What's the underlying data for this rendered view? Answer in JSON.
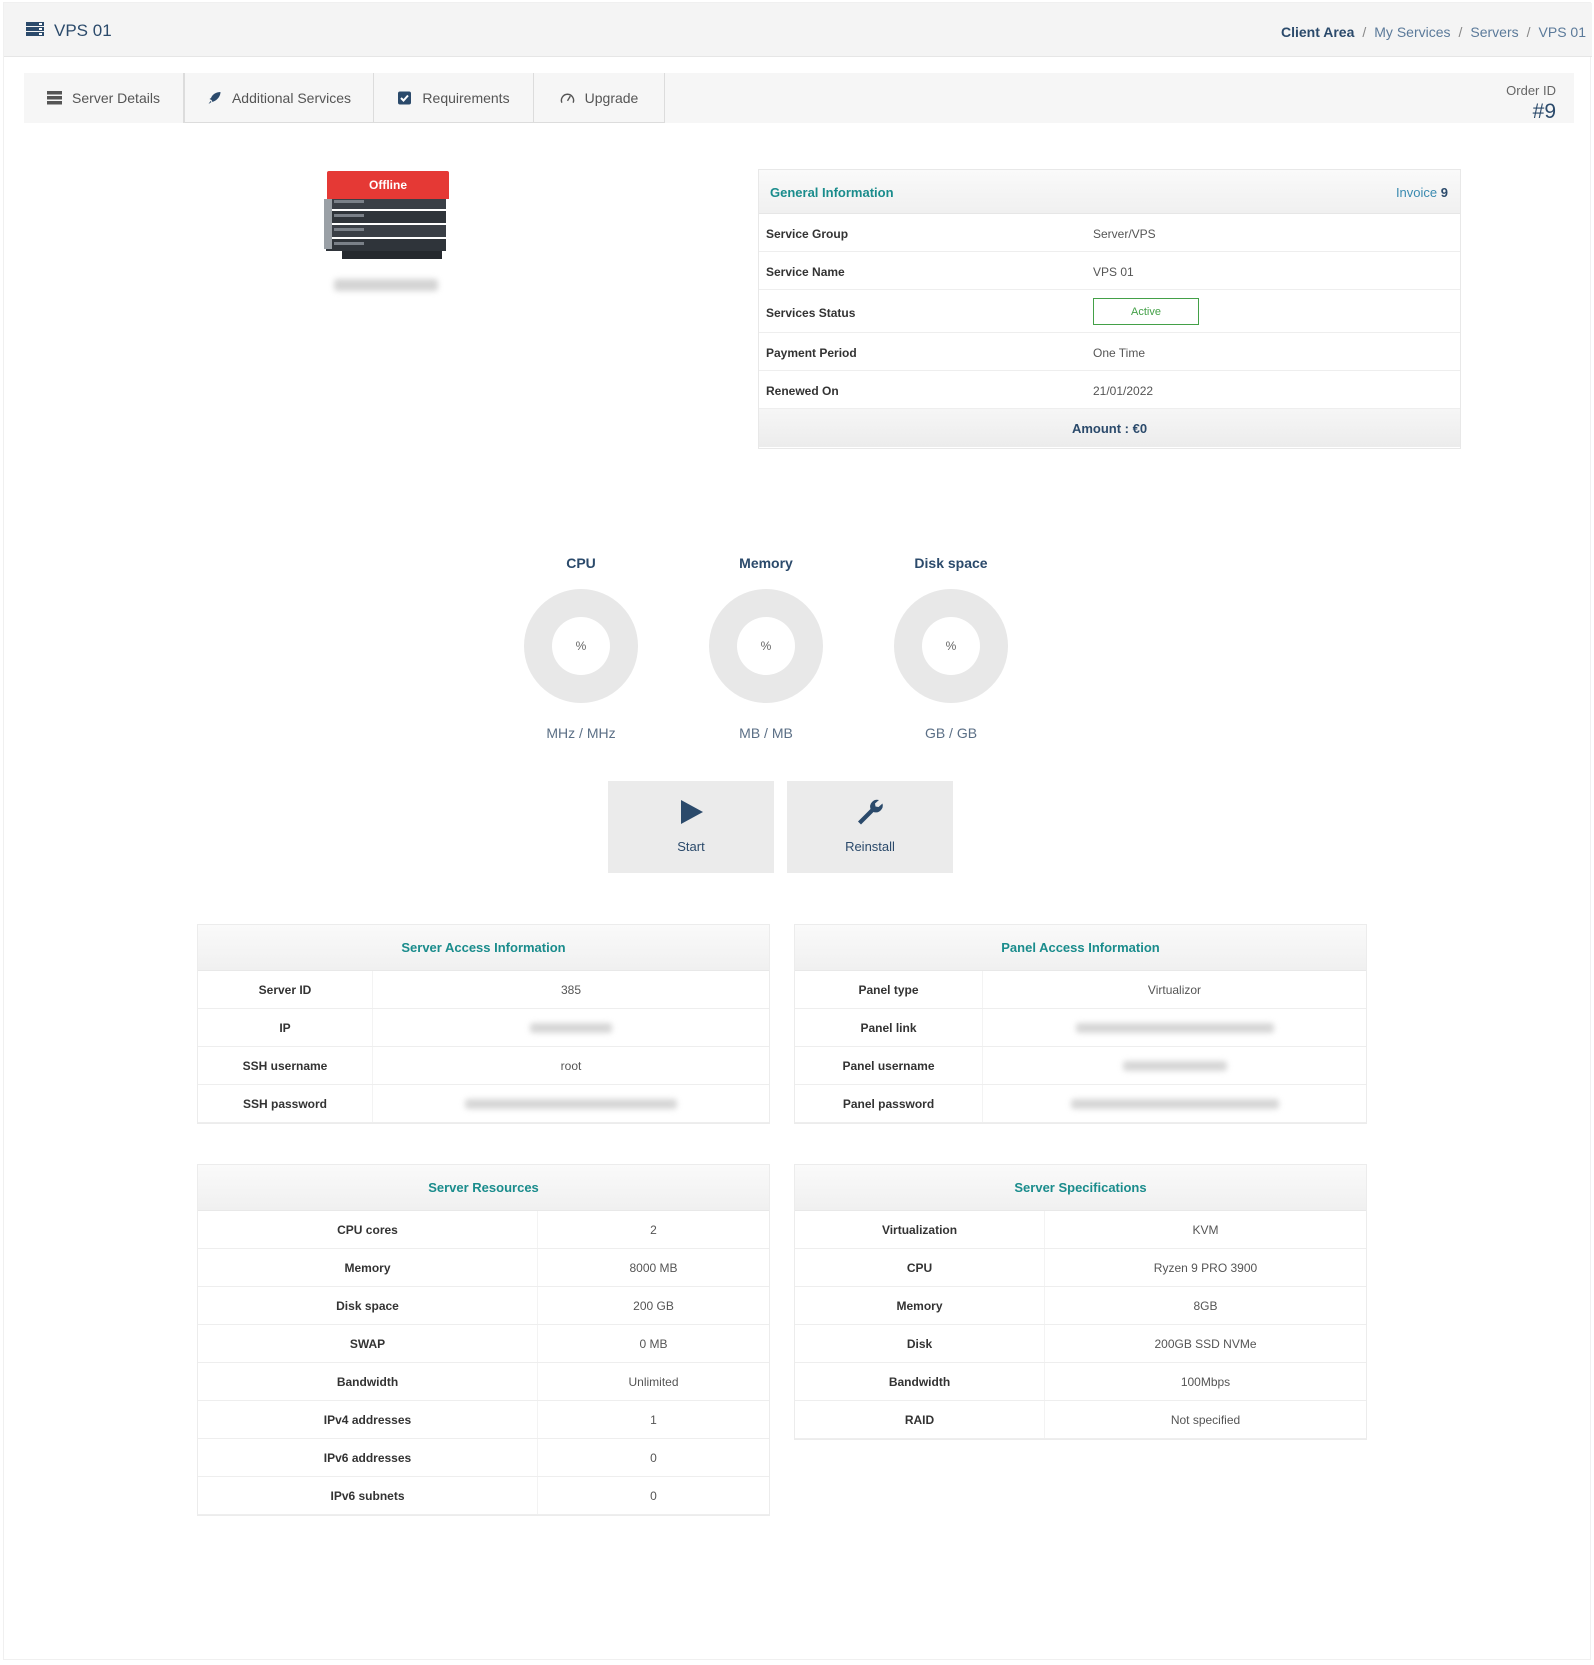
{
  "header": {
    "title": "VPS 01",
    "breadcrumb": {
      "client_area": "Client Area",
      "my_services": "My Services",
      "servers": "Servers",
      "current": "VPS 01",
      "separator": "/"
    }
  },
  "tabs": [
    {
      "label": "Server Details",
      "icon": "server-icon"
    },
    {
      "label": "Additional Services",
      "icon": "rocket-icon"
    },
    {
      "label": "Requirements",
      "icon": "checkbox-icon"
    },
    {
      "label": "Upgrade",
      "icon": "gauge-icon"
    }
  ],
  "order": {
    "label": "Order ID",
    "value": "#9"
  },
  "server_status_badge": "Offline",
  "general": {
    "title": "General Information",
    "invoice_label": "Invoice",
    "invoice_number": "9",
    "rows": [
      {
        "key": "Service Group",
        "value": "Server/VPS"
      },
      {
        "key": "Service Name",
        "value": "VPS 01"
      },
      {
        "key": "Services Status",
        "value": "Active"
      },
      {
        "key": "Payment Period",
        "value": "One Time"
      },
      {
        "key": "Renewed On",
        "value": "21/01/2022"
      }
    ],
    "amount": "Amount : €0"
  },
  "gauges": [
    {
      "name": "CPU",
      "center": "%",
      "unit": "MHz / MHz"
    },
    {
      "name": "Memory",
      "center": "%",
      "unit": "MB / MB"
    },
    {
      "name": "Disk space",
      "center": "%",
      "unit": "GB / GB"
    }
  ],
  "actions": {
    "start": "Start",
    "reinstall": "Reinstall"
  },
  "server_access": {
    "title": "Server Access Information",
    "rows": [
      {
        "key": "Server ID",
        "value": "385"
      },
      {
        "key": "IP",
        "value": ""
      },
      {
        "key": "SSH username",
        "value": "root"
      },
      {
        "key": "SSH password",
        "value": ""
      }
    ]
  },
  "panel_access": {
    "title": "Panel Access Information",
    "rows": [
      {
        "key": "Panel type",
        "value": "Virtualizor"
      },
      {
        "key": "Panel link",
        "value": ""
      },
      {
        "key": "Panel username",
        "value": ""
      },
      {
        "key": "Panel password",
        "value": ""
      }
    ]
  },
  "server_resources": {
    "title": "Server Resources",
    "rows": [
      {
        "key": "CPU cores",
        "value": "2"
      },
      {
        "key": "Memory",
        "value": "8000 MB"
      },
      {
        "key": "Disk space",
        "value": "200 GB"
      },
      {
        "key": "SWAP",
        "value": "0 MB"
      },
      {
        "key": "Bandwidth",
        "value": "Unlimited"
      },
      {
        "key": "IPv4 addresses",
        "value": "1"
      },
      {
        "key": "IPv6 addresses",
        "value": "0"
      },
      {
        "key": "IPv6 subnets",
        "value": "0"
      }
    ]
  },
  "server_specs": {
    "title": "Server Specifications",
    "rows": [
      {
        "key": "Virtualization",
        "value": "KVM"
      },
      {
        "key": "CPU",
        "value": "Ryzen 9 PRO 3900"
      },
      {
        "key": "Memory",
        "value": "8GB"
      },
      {
        "key": "Disk",
        "value": "200GB SSD NVMe"
      },
      {
        "key": "Bandwidth",
        "value": "100Mbps"
      },
      {
        "key": "RAID",
        "value": "Not specified"
      }
    ]
  },
  "colors": {
    "accent_teal": "#1a8c8c",
    "navy": "#2b4a6b",
    "offline_red": "#e53935",
    "active_green": "#43a047"
  }
}
